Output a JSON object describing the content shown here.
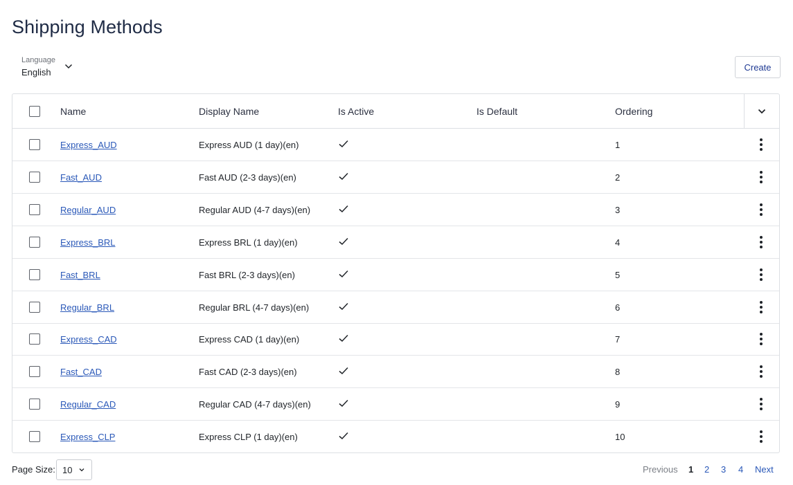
{
  "page": {
    "title": "Shipping Methods"
  },
  "language": {
    "label": "Language",
    "value": "English"
  },
  "toolbar": {
    "create_label": "Create"
  },
  "table": {
    "headers": {
      "name": "Name",
      "display_name": "Display Name",
      "is_active": "Is Active",
      "is_default": "Is Default",
      "ordering": "Ordering"
    },
    "rows": [
      {
        "name": "Express_AUD",
        "display_name": "Express AUD (1 day)(en)",
        "is_active": true,
        "is_default": false,
        "ordering": "1"
      },
      {
        "name": "Fast_AUD",
        "display_name": "Fast AUD (2-3 days)(en)",
        "is_active": true,
        "is_default": false,
        "ordering": "2"
      },
      {
        "name": "Regular_AUD",
        "display_name": "Regular AUD (4-7 days)(en)",
        "is_active": true,
        "is_default": false,
        "ordering": "3"
      },
      {
        "name": "Express_BRL",
        "display_name": "Express BRL (1 day)(en)",
        "is_active": true,
        "is_default": false,
        "ordering": "4"
      },
      {
        "name": "Fast_BRL",
        "display_name": "Fast BRL (2-3 days)(en)",
        "is_active": true,
        "is_default": false,
        "ordering": "5"
      },
      {
        "name": "Regular_BRL",
        "display_name": "Regular BRL (4-7 days)(en)",
        "is_active": true,
        "is_default": false,
        "ordering": "6"
      },
      {
        "name": "Express_CAD",
        "display_name": "Express CAD (1 day)(en)",
        "is_active": true,
        "is_default": false,
        "ordering": "7"
      },
      {
        "name": "Fast_CAD",
        "display_name": "Fast CAD (2-3 days)(en)",
        "is_active": true,
        "is_default": false,
        "ordering": "8"
      },
      {
        "name": "Regular_CAD",
        "display_name": "Regular CAD (4-7 days)(en)",
        "is_active": true,
        "is_default": false,
        "ordering": "9"
      },
      {
        "name": "Express_CLP",
        "display_name": "Express CLP (1 day)(en)",
        "is_active": true,
        "is_default": false,
        "ordering": "10"
      }
    ]
  },
  "footer": {
    "page_size_label": "Page Size:",
    "page_size_value": "10",
    "previous_label": "Previous",
    "next_label": "Next",
    "pages": [
      "1",
      "2",
      "3",
      "4"
    ],
    "current_page": "1"
  },
  "colors": {
    "link": "#2a58b8",
    "title": "#1f2b45",
    "border": "#dcdfe3"
  }
}
